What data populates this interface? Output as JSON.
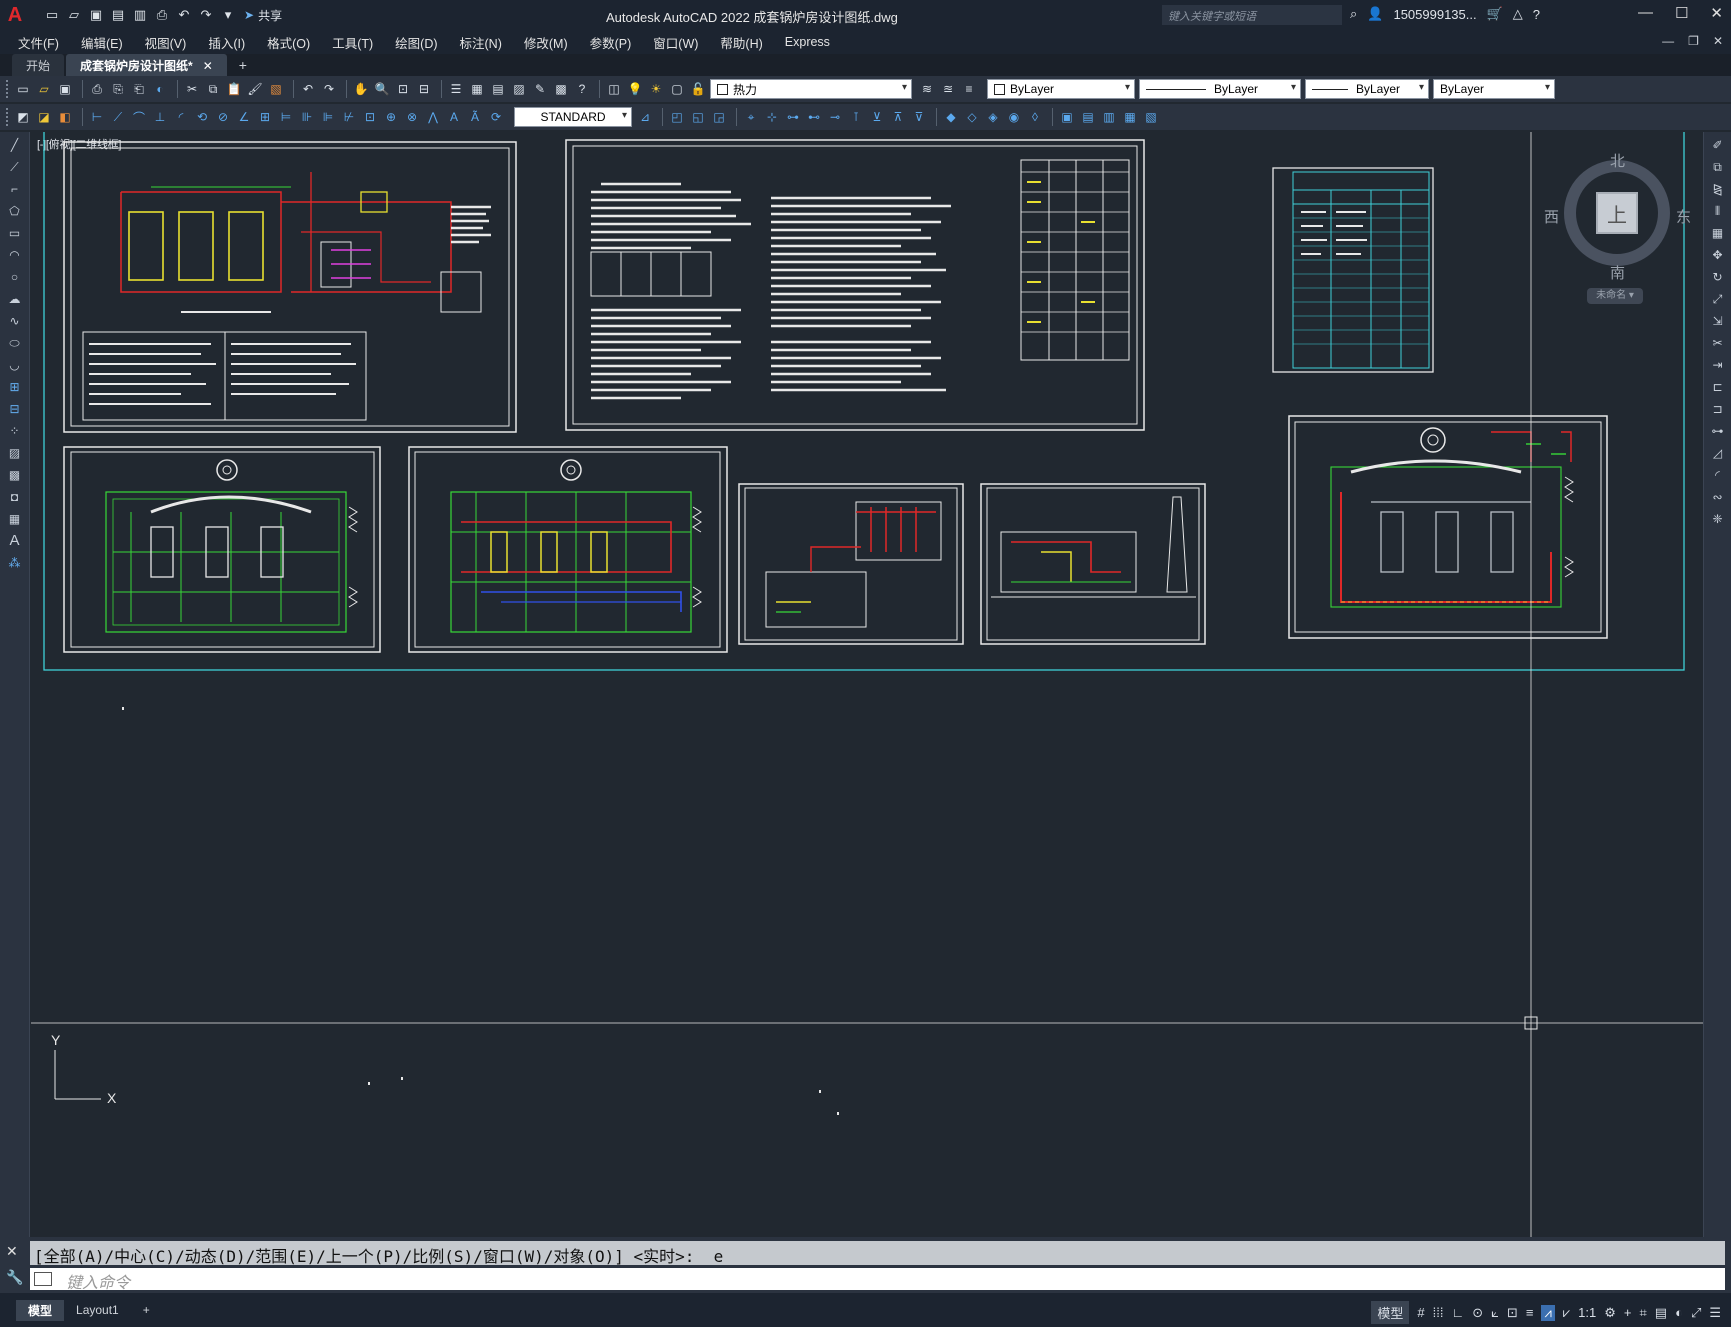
{
  "app": {
    "logo": "A",
    "title": "Autodesk AutoCAD 2022    成套锅炉房设计图纸.dwg",
    "search_placeholder": "键入关键字或短语",
    "user": "1505999135...",
    "share_label": "共享"
  },
  "menu": [
    "文件(F)",
    "编辑(E)",
    "视图(V)",
    "插入(I)",
    "格式(O)",
    "工具(T)",
    "绘图(D)",
    "标注(N)",
    "修改(M)",
    "参数(P)",
    "窗口(W)",
    "帮助(H)",
    "Express"
  ],
  "tabs": {
    "start": "开始",
    "drawing": "成套锅炉房设计图纸*"
  },
  "toolbar": {
    "layer_name": "热力",
    "text_style": "STANDARD",
    "color": "ByLayer",
    "linetype": "ByLayer",
    "lineweight": "ByLayer",
    "plotstyle": "ByLayer"
  },
  "viewport": {
    "label": "[-][俯视][二维线框]"
  },
  "viewcube": {
    "north": "北",
    "south": "南",
    "east": "东",
    "west": "西",
    "face": "上",
    "wcs": "未命名 ▾"
  },
  "ucs": {
    "x": "X",
    "y": "Y"
  },
  "command": {
    "history": "[全部(A)/中心(C)/动态(D)/范围(E)/上一个(P)/比例(S)/窗口(W)/对象(O)] <实时>: _e",
    "placeholder": "键入命令"
  },
  "layout_tabs": [
    "模型",
    "Layout1"
  ],
  "status": {
    "model_label": "模型",
    "scale": "1:1"
  },
  "colors": {
    "canvas_bg": "#212830",
    "frame_cyan": "#3fd0d8",
    "line_red": "#e02828",
    "line_green": "#38d838",
    "line_yellow": "#e8e030",
    "line_blue": "#3050e8"
  }
}
